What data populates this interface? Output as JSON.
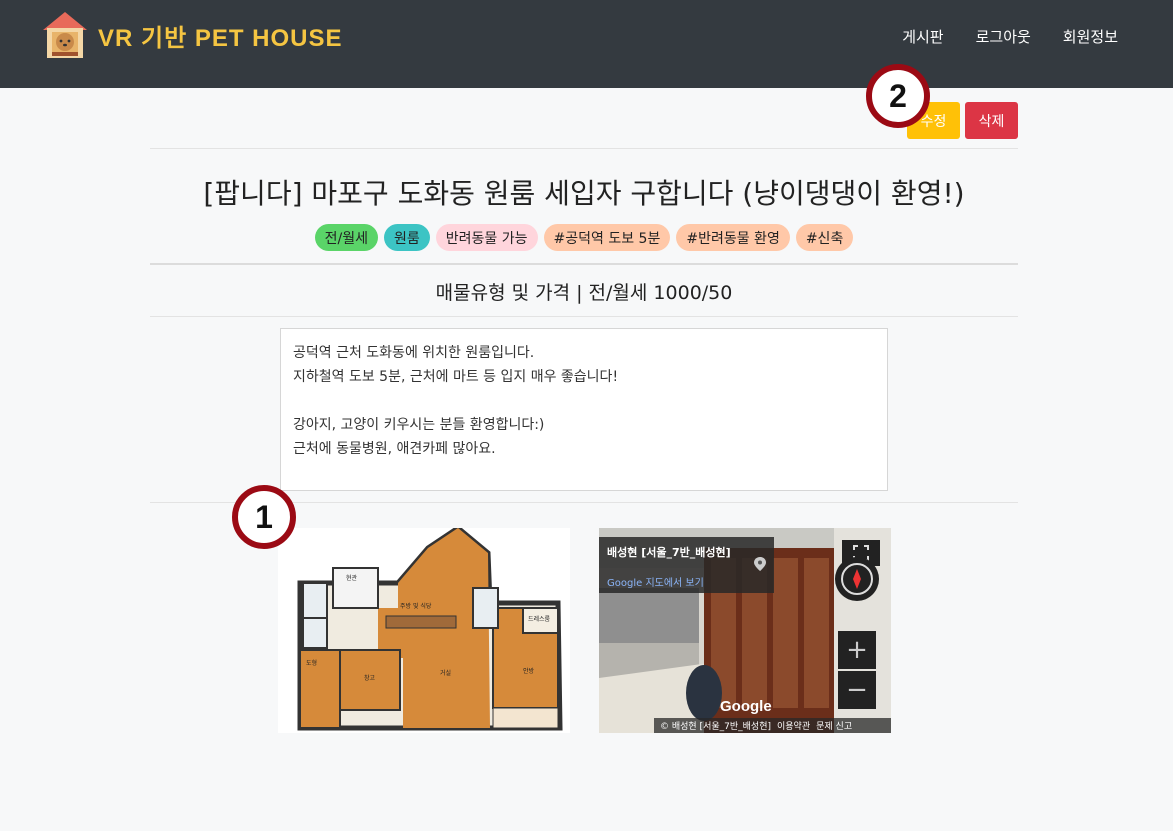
{
  "brand": {
    "title": "VR 기반 PET HOUSE"
  },
  "nav": {
    "items": [
      "게시판",
      "로그아웃",
      "회원정보"
    ]
  },
  "actions": {
    "edit_label": "수정",
    "delete_label": "삭제"
  },
  "markers": {
    "one": "1",
    "two": "2"
  },
  "post": {
    "title": "[팝니다] 마포구 도화동 원룸 세입자 구합니다 (냥이댕댕이 환영!)",
    "tags": [
      {
        "label": "전/월세",
        "color": "#5ad468"
      },
      {
        "label": "원룸",
        "color": "#3cc4c4"
      },
      {
        "label": "반려동물 가능",
        "color": "#ffd5dc"
      },
      {
        "label": "#공덕역 도보 5분",
        "color": "#ffc8a8"
      },
      {
        "label": "#반려동물 환영",
        "color": "#ffc8a8"
      },
      {
        "label": "#신축",
        "color": "#ffc8a8"
      }
    ],
    "price_line": "매물유형 및 가격 | 전/월세 1000/50",
    "description": [
      "공덕역 근처 도화동에 위치한 원룸입니다.",
      "지하철역 도보 5분, 근처에 마트 등 입지 매우 좋습니다!",
      "",
      "강아지, 고양이 키우시는 분들 환영합니다:)",
      "근처에 동물병원, 애견카페 많아요."
    ]
  },
  "floorplan": {
    "rooms": [
      "현관",
      "주방 및 식당",
      "드레스룸",
      "도형",
      "창고",
      "거실",
      "안방"
    ]
  },
  "streetview": {
    "name": "배성현 [서울_7반_배성현]",
    "map_link": "Google 지도에서 보기",
    "logo": "Google",
    "footer": [
      "© 배성현 [서울_7반_배성현]",
      "이용약관",
      "문제 신고"
    ]
  }
}
